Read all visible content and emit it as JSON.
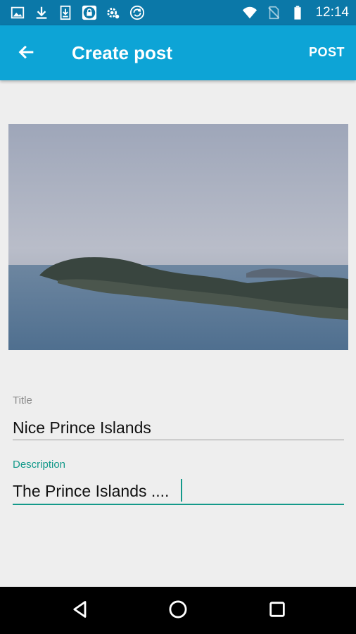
{
  "status_bar": {
    "time": "12:14",
    "icons_left": [
      "image-icon",
      "download-icon",
      "download-box-icon",
      "lock-icon",
      "settings-gear-icon",
      "sync-icon"
    ],
    "icons_right": [
      "wifi-icon",
      "no-sim-icon",
      "battery-icon"
    ]
  },
  "app_bar": {
    "title": "Create post",
    "action_label": "POST",
    "background": "#0da4d6"
  },
  "form": {
    "title_label": "Title",
    "title_value": "Nice Prince Islands",
    "description_label": "Description",
    "description_value": "The Prince Islands ....",
    "accent_color": "#13998a"
  },
  "nav_bar": {
    "icons": [
      "back-triangle-icon",
      "home-circle-icon",
      "recent-square-icon"
    ]
  }
}
